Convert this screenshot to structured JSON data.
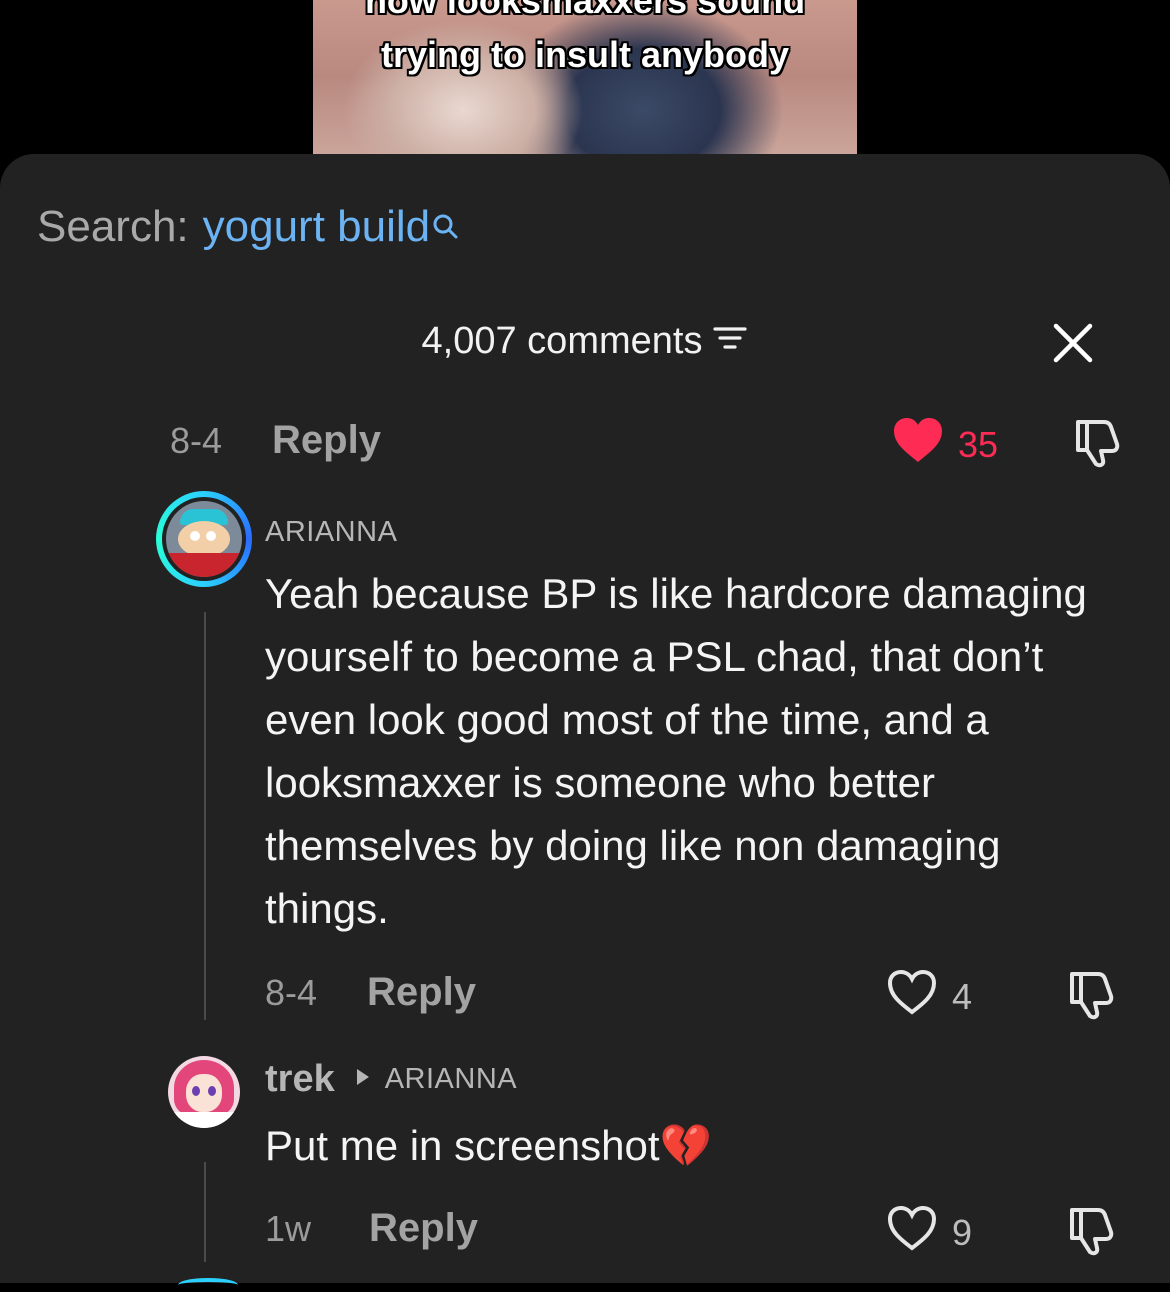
{
  "video": {
    "caption_line1": "how looksmaxxers sound",
    "caption_line2": "trying to insult anybody"
  },
  "search": {
    "label": "Search:",
    "query": "yogurt build"
  },
  "header": {
    "comment_count": "4,007 comments"
  },
  "top_comment": {
    "date": "8-4",
    "reply_label": "Reply",
    "likes": "35",
    "liked": true
  },
  "comments": [
    {
      "username": "ARIANNA",
      "text": "Yeah because BP is like hardcore damaging yourself to become a PSL chad, that don’t even look good most of the time, and a looksmaxxer is someone who better themselves by doing like non damaging things.",
      "date": "8-4",
      "reply_label": "Reply",
      "likes": "4"
    },
    {
      "username": "trek",
      "reply_to": "ARIANNA",
      "text": "Put me in screenshot",
      "emoji": "💔",
      "date": "1w",
      "reply_label": "Reply",
      "likes": "9"
    }
  ],
  "colors": {
    "accent_blue": "#6cb3f3",
    "like_red": "#fe2c55",
    "sheet_bg": "#222222"
  }
}
